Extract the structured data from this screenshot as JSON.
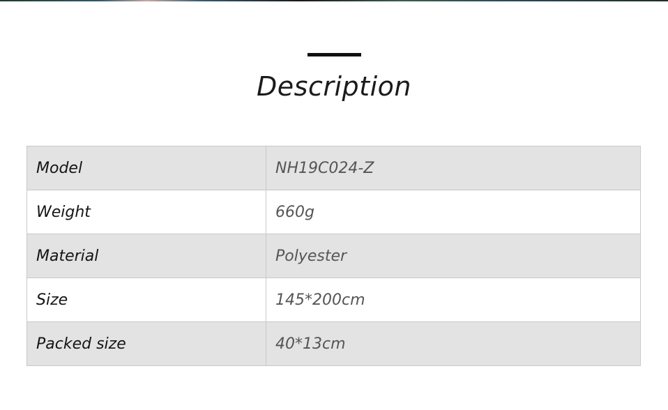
{
  "section": {
    "title": "Description"
  },
  "specs": [
    {
      "label": "Model",
      "value": "NH19C024-Z"
    },
    {
      "label": "Weight",
      "value": "660g"
    },
    {
      "label": "Material",
      "value": "Polyester"
    },
    {
      "label": "Size",
      "value": "145*200cm"
    },
    {
      "label": "Packed size",
      "value": "40*13cm"
    }
  ]
}
